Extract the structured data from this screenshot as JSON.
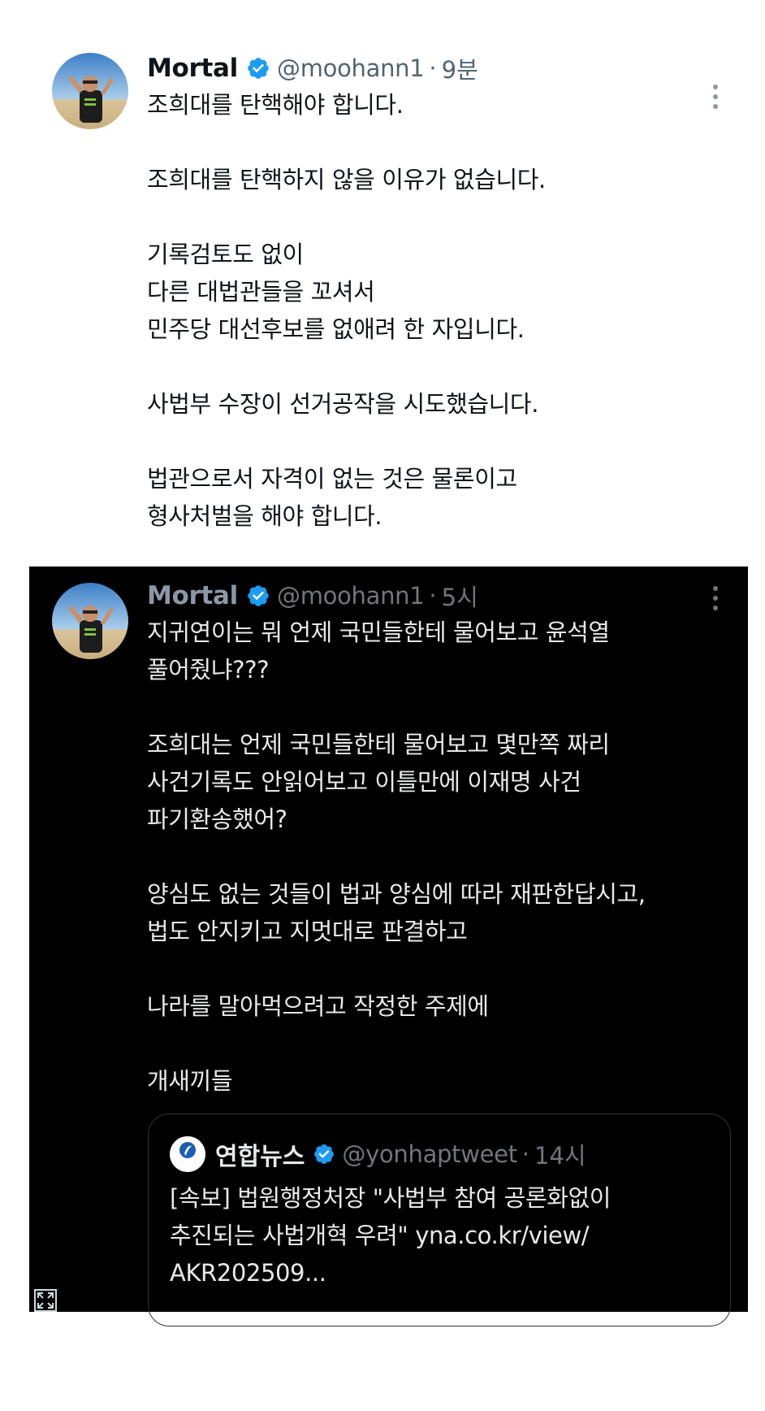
{
  "tweet1": {
    "author_name": "Mortal",
    "handle": "@moohann1",
    "separator": "·",
    "time": "9분",
    "lines": [
      "조희대를 탄핵해야 합니다.",
      "",
      "조희대를 탄핵하지 않을 이유가 없습니다.",
      "",
      "기록검토도 없이",
      "다른 대법관들을 꼬셔서",
      "민주당 대선후보를 없애려 한 자입니다.",
      "",
      "사법부 수장이 선거공작을 시도했습니다.",
      "",
      "법관으로서 자격이 없는 것은 물론이고",
      "형사처벌을 해야 합니다."
    ]
  },
  "tweet2": {
    "author_name": "Mortal",
    "handle": "@moohann1",
    "separator": "·",
    "time": "5시",
    "lines": [
      "지귀연이는 뭐 언제 국민들한테 물어보고 윤석열",
      "풀어줬냐???",
      "",
      "조희대는 언제 국민들한테 물어보고 몇만쪽 짜리",
      "사건기록도 안읽어보고 이틀만에 이재명 사건",
      "파기환송했어?",
      "",
      "양심도 없는 것들이 법과 양심에 따라 재판한답시고,",
      "법도 안지키고 지멋대로 판결하고",
      "",
      "나라를 말아먹으려고 작정한 주제에",
      "",
      "개새끼들"
    ],
    "quote": {
      "author_name": "연합뉴스",
      "handle": "@yonhaptweet",
      "separator": "·",
      "time": "14시",
      "logo_text": "연합뉴스",
      "lines": [
        "[속보] 법원행정처장 \"사법부 참여 공론화없이",
        "추진되는 사법개혁 우려\" yna.co.kr/view/",
        "AKR202509..."
      ]
    }
  },
  "colors": {
    "verified_blue": "#1d9bf0",
    "dark_bg": "#000000",
    "light_text": "#0f1419",
    "muted_text": "#536471"
  },
  "icons": [
    "verified-badge-icon",
    "more-options-icon",
    "expand-media-icon"
  ]
}
